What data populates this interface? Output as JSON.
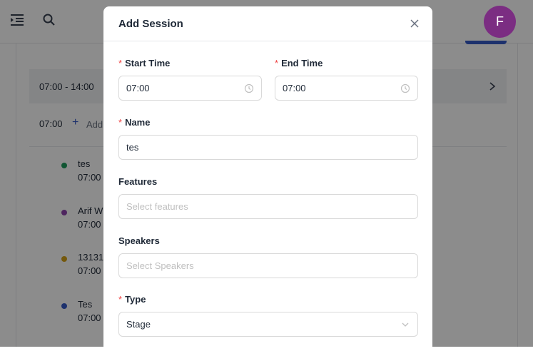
{
  "avatar": {
    "initial": "F"
  },
  "schedule": {
    "time_range": "07:00 - 14:00",
    "time_slot": "07:00",
    "add_label": "Add",
    "sessions": [
      {
        "name": "tes",
        "time": "07:00 -",
        "color": "#1e9b5c"
      },
      {
        "name": "Arif Wi",
        "time": "07:00 -",
        "color": "#8e44ad"
      },
      {
        "name": "13131",
        "time": "07:00 -",
        "color": "#d4a017"
      },
      {
        "name": "Tes",
        "time": "07:00 -",
        "color": "#3659c6"
      }
    ]
  },
  "modal": {
    "title": "Add Session",
    "start_time": {
      "label": "Start Time",
      "value": "07:00",
      "required": "*"
    },
    "end_time": {
      "label": "End Time",
      "value": "07:00",
      "required": "*"
    },
    "name": {
      "label": "Name",
      "value": "tes",
      "required": "*"
    },
    "features": {
      "label": "Features",
      "placeholder": "Select features"
    },
    "speakers": {
      "label": "Speakers",
      "placeholder": "Select Speakers"
    },
    "type": {
      "label": "Type",
      "value": "Stage",
      "required": "*"
    }
  }
}
